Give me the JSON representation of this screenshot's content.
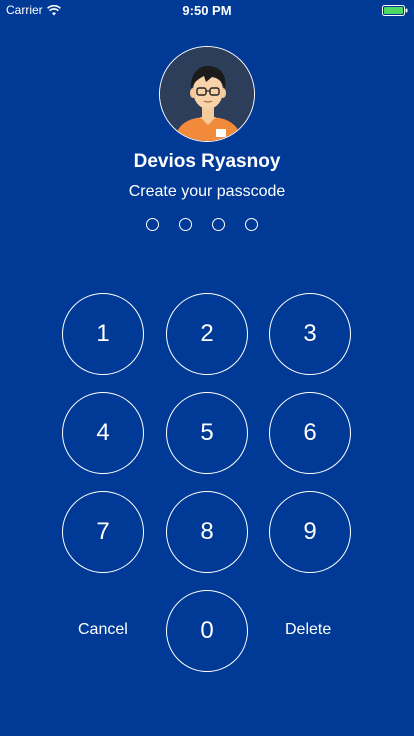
{
  "status_bar": {
    "carrier": "Carrier",
    "time": "9:50 PM"
  },
  "user": {
    "name": "Devios Ryasnoy"
  },
  "prompt": "Create your passcode",
  "passcode": {
    "length": 4,
    "entered": 0
  },
  "keypad": {
    "digits": [
      "1",
      "2",
      "3",
      "4",
      "5",
      "6",
      "7",
      "8",
      "9",
      "0"
    ],
    "cancel_label": "Cancel",
    "delete_label": "Delete"
  },
  "colors": {
    "background": "#003a96",
    "foreground": "#ffffff",
    "battery": "#4cd964"
  }
}
